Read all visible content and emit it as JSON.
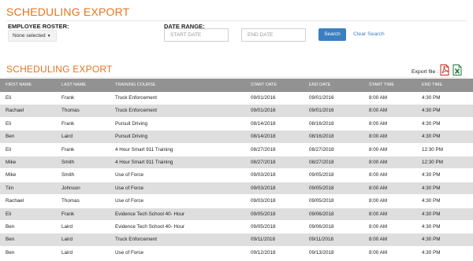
{
  "header": {
    "title": "SCHEDULING EXPORT"
  },
  "filters": {
    "roster_label": "EMPLOYEE ROSTER:",
    "roster_value": "None selected",
    "date_label": "DATE RANGE:",
    "start_placeholder": "START DATE",
    "end_placeholder": "END DATE",
    "search_label": "Search",
    "clear_label": "Clear Search"
  },
  "section": {
    "title": "SCHEDULING EXPORT",
    "export_label": "Export file :"
  },
  "icons": {
    "pdf": "pdf-file-icon",
    "excel": "excel-file-icon"
  },
  "colors": {
    "accent": "#e8741d",
    "primary": "#3b7fc0",
    "header_bg": "#929292",
    "row_alt": "#dedede"
  },
  "table": {
    "columns": [
      "FIRST NAME",
      "LAST NAME",
      "TRAINING COURSE",
      "START DATE",
      "END DATE",
      "START TIME",
      "END TIME"
    ],
    "rows": [
      [
        "Eli",
        "Frank",
        "Truck Enforcement",
        "09/01/2016",
        "09/01/2016",
        "8:00 AM",
        "4:30 PM"
      ],
      [
        "Rachael",
        "Thomas",
        "Truck Enforcement",
        "09/01/2016",
        "09/01/2016",
        "8:00 AM",
        "4:30 PM"
      ],
      [
        "Eli",
        "Frank",
        "Pursuit Driving",
        "08/14/2018",
        "08/16/2018",
        "8:00 AM",
        "4:30 PM"
      ],
      [
        "Ben",
        "Laird",
        "Pursuit Driving",
        "08/14/2018",
        "08/16/2018",
        "8:00 AM",
        "4:30 PM"
      ],
      [
        "Eli",
        "Frank",
        "4 Hour Smart 911 Training",
        "08/27/2018",
        "08/27/2018",
        "8:00 AM",
        "12:30 PM"
      ],
      [
        "Mike",
        "Smith",
        "4 Hour Smart 911 Training",
        "08/27/2018",
        "08/27/2018",
        "8:00 AM",
        "12:30 PM"
      ],
      [
        "Mike",
        "Smith",
        "Use of Force",
        "09/03/2018",
        "09/05/2018",
        "8:00 AM",
        "4:30 PM"
      ],
      [
        "Tim",
        "Johnson",
        "Use of Force",
        "09/03/2018",
        "09/05/2018",
        "8:00 AM",
        "4:30 PM"
      ],
      [
        "Rachael",
        "Thomas",
        "Use of Force",
        "09/03/2018",
        "09/05/2018",
        "8:00 AM",
        "4:30 PM"
      ],
      [
        "Eli",
        "Frank",
        "Evidence Tech School 40- Hour",
        "09/05/2018",
        "09/06/2018",
        "8:00 AM",
        "4:30 PM"
      ],
      [
        "Ben",
        "Laird",
        "Evidence Tech School 40- Hour",
        "09/05/2018",
        "09/06/2018",
        "8:00 AM",
        "4:30 PM"
      ],
      [
        "Ben",
        "Laird",
        "Truck Enforcement",
        "09/11/2018",
        "09/11/2018",
        "8:00 AM",
        "4:30 PM"
      ],
      [
        "Ben",
        "Laird",
        "Use of Force",
        "09/12/2018",
        "09/13/2018",
        "8:00 AM",
        "4:30 PM"
      ]
    ]
  }
}
